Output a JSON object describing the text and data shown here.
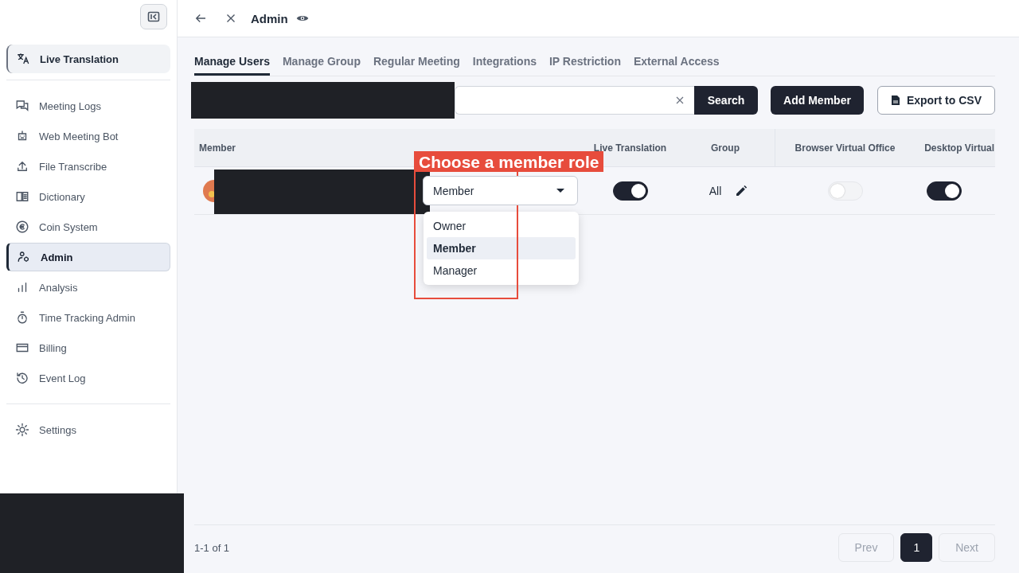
{
  "sidebar": {
    "pinned_item": {
      "label": "Live Translation"
    },
    "items": [
      {
        "label": "Meeting Logs",
        "selected": false
      },
      {
        "label": "Web Meeting Bot",
        "selected": false
      },
      {
        "label": "File Transcribe",
        "selected": false
      },
      {
        "label": "Dictionary",
        "selected": false
      },
      {
        "label": "Coin System",
        "selected": false
      },
      {
        "label": "Admin",
        "selected": true
      },
      {
        "label": "Analysis",
        "selected": false
      },
      {
        "label": "Time Tracking Admin",
        "selected": false
      },
      {
        "label": "Billing",
        "selected": false
      },
      {
        "label": "Event Log",
        "selected": false
      }
    ],
    "footer_items": [
      {
        "label": "Settings",
        "selected": false
      }
    ]
  },
  "header": {
    "title": "Admin"
  },
  "tabs": [
    {
      "label": "Manage Users",
      "selected": true
    },
    {
      "label": "Manage Group",
      "selected": false
    },
    {
      "label": "Regular Meeting",
      "selected": false
    },
    {
      "label": "Integrations",
      "selected": false
    },
    {
      "label": "IP Restriction",
      "selected": false
    },
    {
      "label": "External Access",
      "selected": false
    }
  ],
  "toolbar": {
    "search_button": "Search",
    "add_button": "Add Member",
    "export_button": "Export to CSV"
  },
  "table": {
    "columns": [
      "Member",
      "",
      "Live Translation",
      "Group",
      "Browser Virtual Office",
      "Desktop Virtual"
    ],
    "rows": [
      {
        "role": "Member",
        "live_translation": true,
        "group": "All",
        "browser_virtual_office": false,
        "desktop_virtual": true
      }
    ]
  },
  "role_menu": {
    "options": [
      {
        "label": "Owner",
        "selected": false
      },
      {
        "label": "Member",
        "selected": true
      },
      {
        "label": "Manager",
        "selected": false
      }
    ]
  },
  "annotation": {
    "label": "Choose a member role"
  },
  "footer": {
    "range": "1-1 of 1",
    "prev": "Prev",
    "next": "Next",
    "pages": [
      {
        "label": "1",
        "selected": true
      }
    ],
    "prev_disabled": true,
    "next_disabled": true
  }
}
